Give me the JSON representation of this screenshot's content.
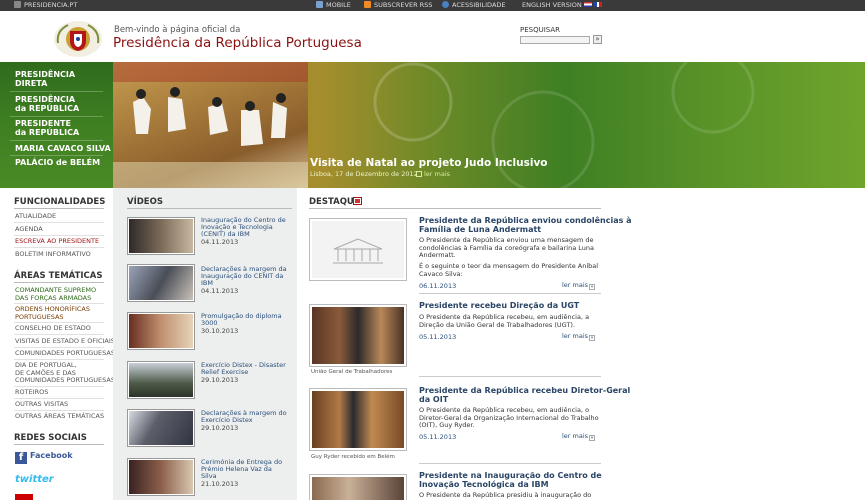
{
  "topbar": {
    "site": "PRESIDENCIA.PT",
    "mobile": "MOBILE",
    "rss": "SUBSCREVER RSS",
    "accessibility": "ACESSIBILIDADE",
    "english": "ENGLISH VERSION"
  },
  "header": {
    "welcome": "Bem-vindo à página oficial da",
    "title": "Presidência da República Portuguesa",
    "search_label": "PESQUISAR",
    "search_button": "»"
  },
  "nav": {
    "items": [
      "PRESIDÊNCIA\nDIRETA",
      "PRESIDÊNCIA\nda REPÚBLICA",
      "PRESIDENTE\nda REPÚBLICA",
      "MARIA CAVACO SILVA",
      "PALÁCIO de BELÉM"
    ]
  },
  "banner": {
    "caption": "Visita de Natal ao projeto Judo Inclusivo",
    "date": "Lisboa, 17 de Dezembro de 2012",
    "more": "ler mais"
  },
  "sidebar": {
    "funcionalidades_title": "FUNCIONALIDADES",
    "funcionalidades": [
      "ATUALIDADE",
      "AGENDA",
      "ESCREVA AO PRESIDENTE",
      "BOLETIM INFORMATIVO"
    ],
    "areas_title": "ÁREAS TEMÁTICAS",
    "areas": [
      "COMANDANTE SUPREMO\nDAS FORÇAS ARMADAS",
      "ORDENS HONORÍFICAS\nPORTUGUESAS",
      "CONSELHO DE ESTADO",
      "VISITAS DE ESTADO E OFICIAIS",
      "COMUNIDADES PORTUGUESAS",
      "DIA DE PORTUGAL,\nDE CAMÕES E DAS\nCOMUNIDADES PORTUGUESAS",
      "ROTEIROS",
      "OUTRAS VISITAS",
      "OUTRAS ÁREAS TEMÁTICAS"
    ],
    "redes_title": "REDES SOCIAIS",
    "facebook": "Facebook",
    "twitter": "twitter"
  },
  "videos": {
    "title": "VÍDEOS",
    "items": [
      {
        "title": "Inauguração do Centro de\nInovação e Tecnologia\n(CENIT) da IBM",
        "date": "04.11.2013"
      },
      {
        "title": "Declarações à margem da\nInauguração do CENIT da\nIBM",
        "date": "04.11.2013"
      },
      {
        "title": "Promulgação do diploma\n3000",
        "date": "30.10.2013"
      },
      {
        "title": "Exercício Distex - Disaster\nRelief Exercise",
        "date": "29.10.2013"
      },
      {
        "title": "Declarações à margem do\nExercício Distex",
        "date": "29.10.2013"
      },
      {
        "title": "Cerimónia de Entrega do\nPrémio Helena Vaz da\nSilva",
        "date": "21.10.2013"
      }
    ]
  },
  "destaque": {
    "title": "DESTAQUE",
    "more_label": "ler mais",
    "items": [
      {
        "title": "Presidente da República enviou condolências à\nFamília de Luna Andermatt",
        "body": "O Presidente da República enviou uma mensagem de\ncondolências à Família da coreógrafa e bailarina Luna\nAndermatt.",
        "body2": "É o seguinte o teor da mensagem do Presidente Aníbal\nCavaco Silva:",
        "date": "06.11.2013",
        "caption": ""
      },
      {
        "title": "Presidente recebeu Direção da UGT",
        "body": "O Presidente da República recebeu, em audiência, a\nDireção da União Geral de Trabalhadores (UGT).",
        "body2": "",
        "date": "05.11.2013",
        "caption": "União Geral de Trabalhadores"
      },
      {
        "title": "Presidente da República recebeu Diretor-Geral\nda OIT",
        "body": "O Presidente da República recebeu, em audiência, o\nDiretor-Geral da Organização Internacional do Trabalho\n(OIT), Guy Ryder.",
        "body2": "",
        "date": "05.11.2013",
        "caption": "Guy Ryder recebido em Belém"
      },
      {
        "title": "Presidente na Inauguração do Centro de\nInovação Tecnológica da IBM",
        "body": "O Presidente da República presidiu à inauguração do",
        "body2": "",
        "date": "",
        "caption": ""
      }
    ]
  }
}
